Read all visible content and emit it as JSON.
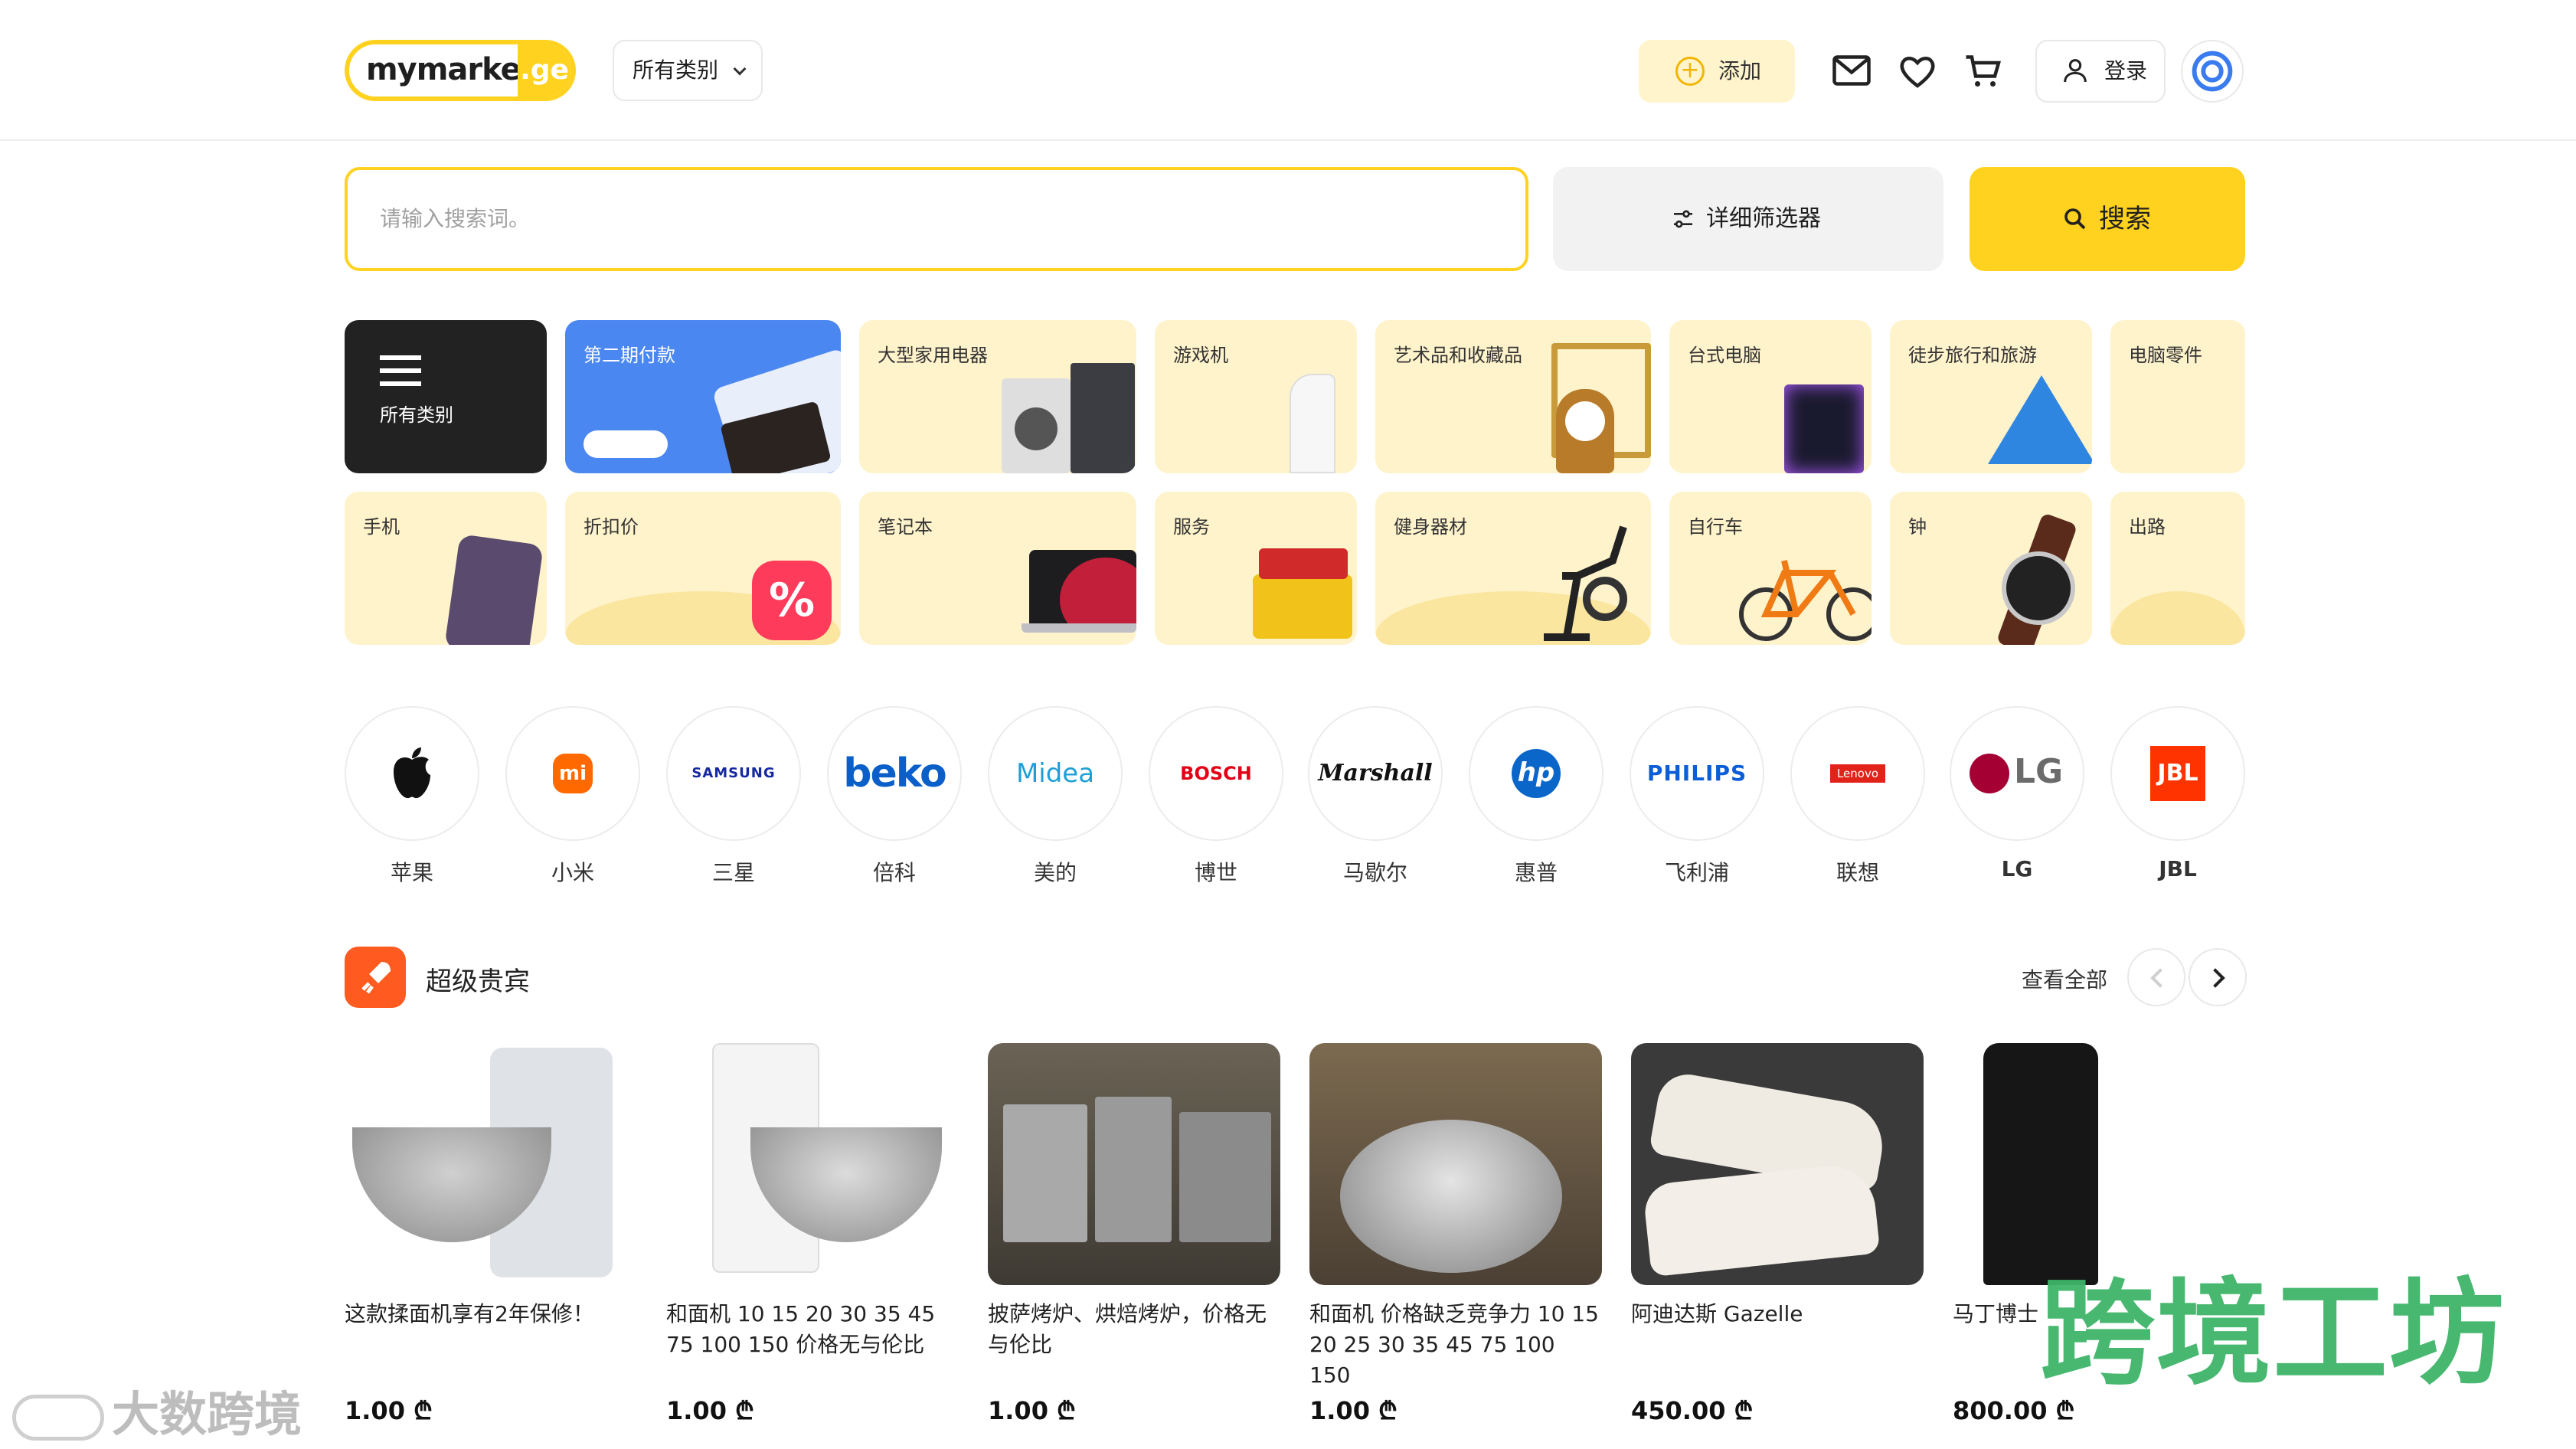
{
  "header": {
    "logo_text": "mymarket",
    "logo_suffix": ".ge",
    "category_select": "所有类别",
    "add_label": "添加",
    "login_label": "登录"
  },
  "search": {
    "placeholder": "请输入搜索词。",
    "filter_label": "详细筛选器",
    "search_label": "搜索"
  },
  "categories": [
    {
      "label": "所有类别",
      "icon": "menu-icon"
    },
    {
      "label": "第二期付款"
    },
    {
      "label": "大型家用电器"
    },
    {
      "label": "游戏机"
    },
    {
      "label": "艺术品和收藏品"
    },
    {
      "label": "台式电脑"
    },
    {
      "label": "徒步旅行和旅游"
    },
    {
      "label": "电脑零件"
    },
    {
      "label": "手机"
    },
    {
      "label": "折扣价"
    },
    {
      "label": "笔记本"
    },
    {
      "label": "服务"
    },
    {
      "label": "健身器材"
    },
    {
      "label": "自行车"
    },
    {
      "label": "钟"
    },
    {
      "label": "出路"
    }
  ],
  "brands": [
    {
      "name": "苹果",
      "logo": ""
    },
    {
      "name": "小米",
      "logo": "mi"
    },
    {
      "name": "三星",
      "logo": "SAMSUNG"
    },
    {
      "name": "倍科",
      "logo": "beko"
    },
    {
      "name": "美的",
      "logo": "Midea"
    },
    {
      "name": "博世",
      "logo": "BOSCH"
    },
    {
      "name": "马歇尔",
      "logo": "Marshall"
    },
    {
      "name": "惠普",
      "logo": "hp"
    },
    {
      "name": "飞利浦",
      "logo": "PHILIPS"
    },
    {
      "name": "联想",
      "logo": "Lenovo"
    },
    {
      "name": "LG",
      "logo": "LG"
    },
    {
      "name": "JBL",
      "logo": "JBL"
    }
  ],
  "vip": {
    "title": "超级贵宾",
    "view_all": "查看全部",
    "products": [
      {
        "title": "这款揉面机享有2年保修！",
        "price": "1.00 ₾"
      },
      {
        "title": "和面机 10 15 20 30 35 45 75 100 150 价格无与伦比",
        "price": "1.00 ₾"
      },
      {
        "title": "披萨烤炉、烘焙烤炉，价格无与伦比",
        "price": "1.00 ₾"
      },
      {
        "title": "和面机 价格缺乏竞争力 10 15 20 25 30 35 45 75 100 150",
        "price": "1.00 ₾"
      },
      {
        "title": "阿迪达斯 Gazelle",
        "price": "450.00 ₾"
      },
      {
        "title": "马丁博士",
        "price": "800.00 ₾"
      }
    ]
  },
  "watermarks": {
    "cn_right": "跨境工坊",
    "cn_left": "大数跨境"
  },
  "colors": {
    "accent": "#ffd21f",
    "tile_bg": "#fff3cc",
    "vip_orange": "#ff5a1f"
  }
}
